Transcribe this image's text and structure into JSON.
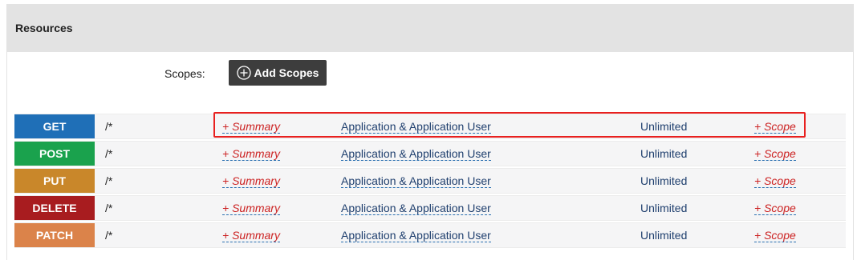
{
  "panel": {
    "title": "Resources"
  },
  "scopes": {
    "label": "Scopes:",
    "add_button_label": "Add Scopes"
  },
  "resources": [
    {
      "verb": "GET",
      "verb_color": "#1f6fb7",
      "path": "/*",
      "summary": "+ Summary",
      "auth": "Application & Application User",
      "throttle": "Unlimited",
      "scope": "+ Scope"
    },
    {
      "verb": "POST",
      "verb_color": "#1aa24d",
      "path": "/*",
      "summary": "+ Summary",
      "auth": "Application & Application User",
      "throttle": "Unlimited",
      "scope": "+ Scope"
    },
    {
      "verb": "PUT",
      "verb_color": "#c9872a",
      "path": "/*",
      "summary": "+ Summary",
      "auth": "Application & Application User",
      "throttle": "Unlimited",
      "scope": "+ Scope"
    },
    {
      "verb": "DELETE",
      "verb_color": "#a81c1f",
      "path": "/*",
      "summary": "+ Summary",
      "auth": "Application & Application User",
      "throttle": "Unlimited",
      "scope": "+ Scope"
    },
    {
      "verb": "PATCH",
      "verb_color": "#db834a",
      "path": "/*",
      "summary": "+ Summary",
      "auth": "Application & Application User",
      "throttle": "Unlimited",
      "scope": "+ Scope"
    }
  ],
  "icons": {
    "add_scopes": "plus-circle-icon"
  }
}
